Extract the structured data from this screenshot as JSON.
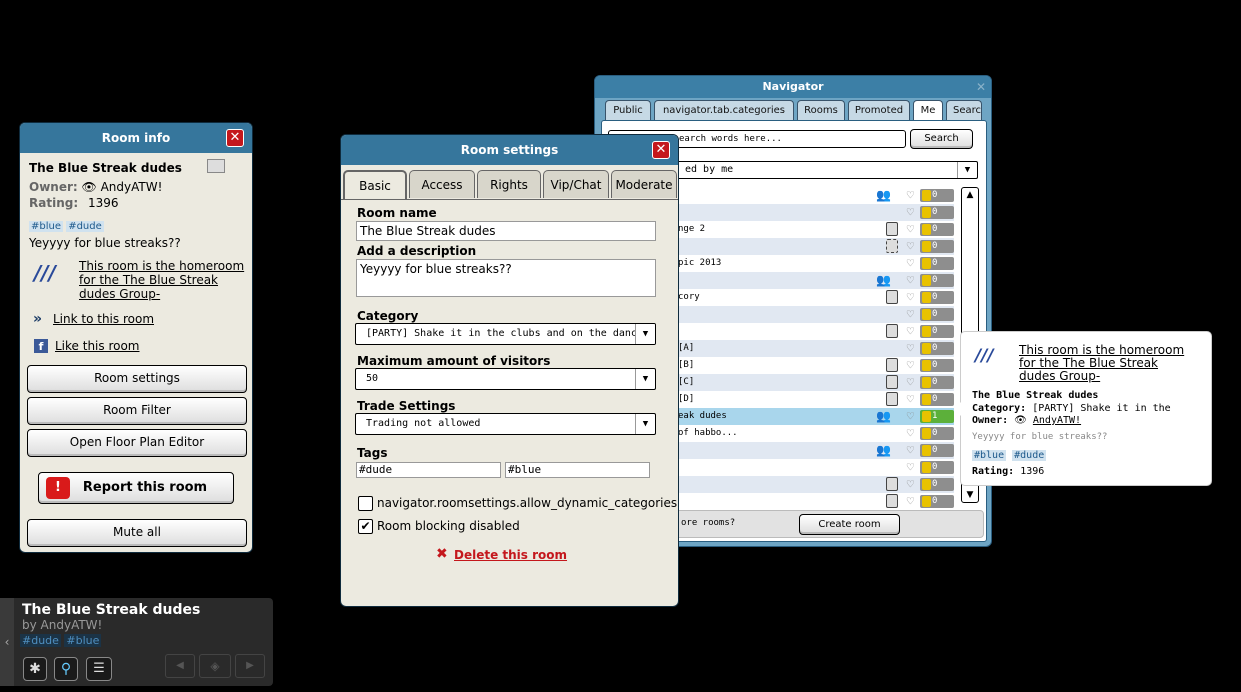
{
  "room_info": {
    "title": "Room info",
    "close": "✕",
    "room_name": "The Blue Streak dudes",
    "owner_label": "Owner:",
    "owner_name": "AndyATW!",
    "rating_label": "Rating:",
    "rating_value": "1396",
    "tags": [
      "#blue",
      "#dude"
    ],
    "description": "Yeyyyy for blue streaks??",
    "group_link": "This room is the homeroom for the The Blue Streak dudes Group-",
    "link_room": "Link to this room",
    "like_room": "Like this room",
    "btn_settings": "Room settings",
    "btn_filter": "Room Filter",
    "btn_floor": "Open Floor Plan Editor",
    "btn_report": "Report this room",
    "btn_mute": "Mute all"
  },
  "room_settings": {
    "title": "Room settings",
    "close": "✕",
    "tabs": [
      "Basic",
      "Access",
      "Rights",
      "Vip/Chat",
      "Moderate"
    ],
    "room_name_label": "Room name",
    "room_name_value": "The Blue Streak dudes",
    "desc_label": "Add a description",
    "desc_value": "Yeyyyy for blue streaks??",
    "category_label": "Category",
    "category_value": "[PARTY] Shake it in the clubs and on the dance floors!",
    "max_visitors_label": "Maximum amount of visitors",
    "max_visitors_value": "50",
    "trade_label": "Trade Settings",
    "trade_value": "Trading not allowed",
    "tags_label": "Tags",
    "tag1": "#dude",
    "tag2": "#blue",
    "check1_label": "navigator.roomsettings.allow_dynamic_categories",
    "check2_label": "Room blocking disabled",
    "delete_label": "Delete this room"
  },
  "navigator": {
    "title": "Navigator",
    "tabs": [
      "Public",
      "navigator.tab.categories",
      "Rooms",
      "Promoted",
      "Me",
      "Search"
    ],
    "search_placeholder": "earch words here...",
    "search_btn": "Search",
    "filter_value": "ed by me",
    "rows": [
      {
        "name": "",
        "icon": "people",
        "count": "0",
        "hl": false
      },
      {
        "name": "",
        "icon": "",
        "count": "0",
        "hl": false
      },
      {
        "name": "nge 2",
        "icon": "lock",
        "count": "0",
        "hl": false
      },
      {
        "name": "",
        "icon": "dash",
        "count": "0",
        "hl": false
      },
      {
        "name": "pic 2013",
        "icon": "",
        "count": "0",
        "hl": false
      },
      {
        "name": "",
        "icon": "people",
        "count": "0",
        "hl": false
      },
      {
        "name": "cory",
        "icon": "lock",
        "count": "0",
        "hl": false
      },
      {
        "name": "",
        "icon": "",
        "count": "0",
        "hl": false
      },
      {
        "name": "",
        "icon": "lock",
        "count": "0",
        "hl": false
      },
      {
        "name": "[A]",
        "icon": "",
        "count": "0",
        "hl": false
      },
      {
        "name": "[B]",
        "icon": "lock",
        "count": "0",
        "hl": false
      },
      {
        "name": "[C]",
        "icon": "lock",
        "count": "0",
        "hl": false
      },
      {
        "name": "[D]",
        "icon": "lock",
        "count": "0",
        "hl": false
      },
      {
        "name": "eak dudes",
        "icon": "people",
        "count": "1",
        "hl": true
      },
      {
        "name": "of habbo...",
        "icon": "",
        "count": "0",
        "hl": false
      },
      {
        "name": "",
        "icon": "people",
        "count": "0",
        "hl": false
      },
      {
        "name": "",
        "icon": "",
        "count": "0",
        "hl": false
      },
      {
        "name": "",
        "icon": "lock",
        "count": "0",
        "hl": false
      },
      {
        "name": "",
        "icon": "lock",
        "count": "0",
        "hl": false
      }
    ],
    "footer_text": "ore rooms?",
    "create_btn": "Create room"
  },
  "tooltip": {
    "group_link": "This room is the homeroom for the The Blue Streak dudes Group-",
    "room_name": "The Blue Streak dudes",
    "category_label": "Category:",
    "category_value": "[PARTY] Shake it in the",
    "owner_label": "Owner:",
    "owner_name": "AndyATW!",
    "description": "Yeyyyy for blue streaks??",
    "tags": [
      "#blue",
      "#dude"
    ],
    "rating_label": "Rating:",
    "rating_value": "1396"
  },
  "room_bar": {
    "room_name": "The Blue Streak dudes",
    "by": "by AndyATW!",
    "tags": [
      "#dude",
      "#blue"
    ]
  }
}
